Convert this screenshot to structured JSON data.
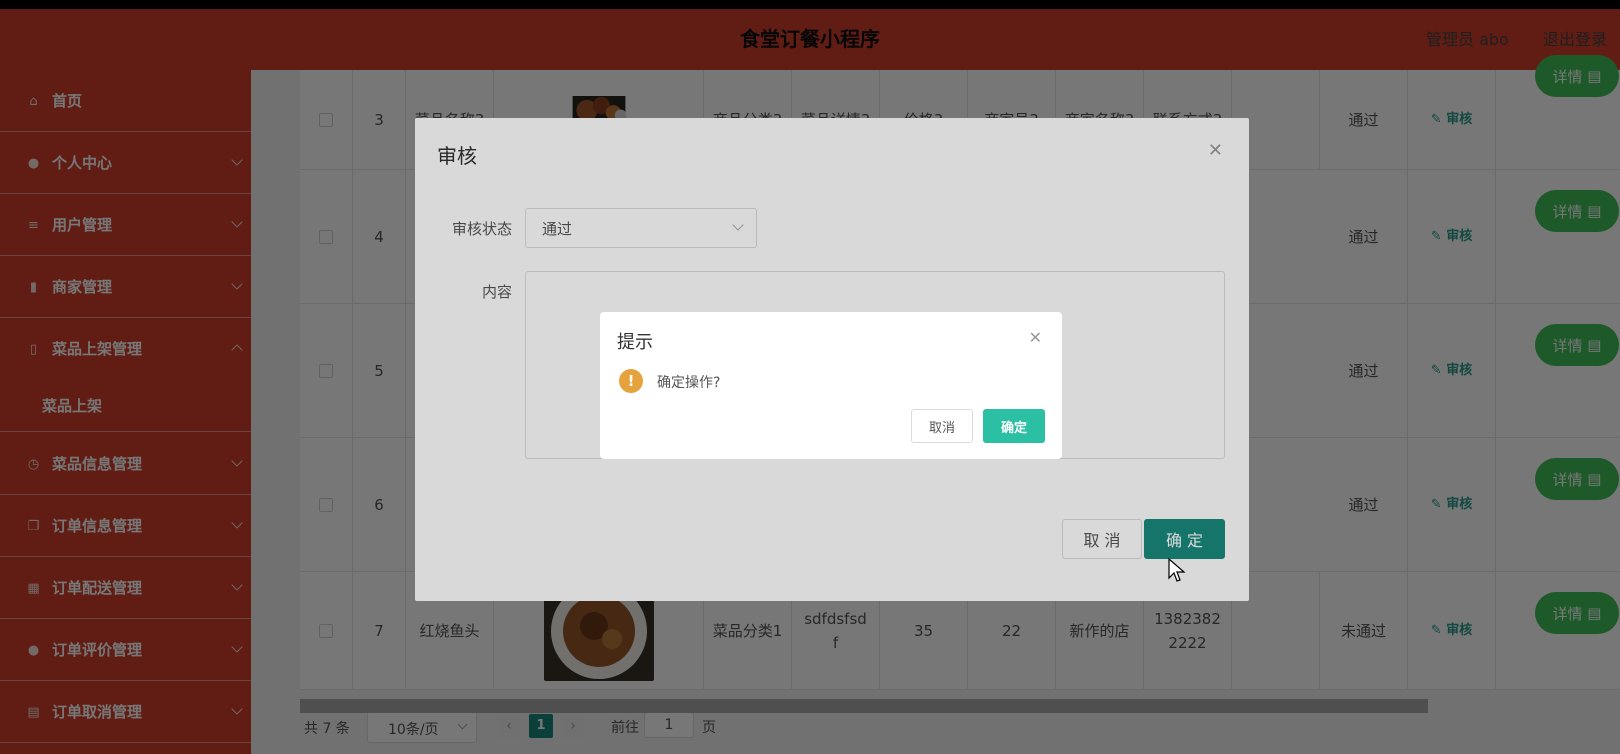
{
  "header": {
    "title": "食堂订餐小程序",
    "admin": "管理员 abo",
    "logout": "退出登录"
  },
  "sidebar": {
    "items": [
      {
        "label": "首页",
        "icon": "home-icon"
      },
      {
        "label": "个人中心",
        "icon": "user-icon"
      },
      {
        "label": "用户管理",
        "icon": "list-icon"
      },
      {
        "label": "商家管理",
        "icon": "bar-chart-icon"
      },
      {
        "label": "菜品上架管理",
        "icon": "phone-icon"
      },
      {
        "label": "菜品上架",
        "icon": ""
      },
      {
        "label": "菜品信息管理",
        "icon": "clock-icon"
      },
      {
        "label": "订单信息管理",
        "icon": "copy-icon"
      },
      {
        "label": "订单配送管理",
        "icon": "grid-icon"
      },
      {
        "label": "订单评价管理",
        "icon": "user-icon"
      },
      {
        "label": "订单取消管理",
        "icon": "doc-icon"
      }
    ]
  },
  "table": {
    "rows": [
      {
        "index": "3",
        "name": "菜品名称3",
        "category": "商品分类3",
        "detail": "菜品详情3",
        "price": "价格3",
        "merchant_no": "商家号3",
        "merchant_name": "商家名称3",
        "contact": "联系方式3",
        "status": "通过",
        "audit": "审核",
        "detail_btn": "详情"
      },
      {
        "index": "4",
        "name": "",
        "category": "",
        "detail": "",
        "price": "",
        "merchant_no": "",
        "merchant_name": "",
        "contact": "",
        "status": "通过",
        "audit": "审核",
        "detail_btn": "详情"
      },
      {
        "index": "5",
        "name": "",
        "category": "",
        "detail": "",
        "price": "",
        "merchant_no": "",
        "merchant_name": "",
        "contact": "",
        "status": "通过",
        "audit": "审核",
        "detail_btn": "详情"
      },
      {
        "index": "6",
        "name": "",
        "category": "",
        "detail": "",
        "price": "",
        "merchant_no": "",
        "merchant_name": "",
        "contact": "",
        "status": "通过",
        "audit": "审核",
        "detail_btn": "详情"
      },
      {
        "index": "7",
        "name": "红烧鱼头",
        "category": "菜品分类1",
        "detail": "sdfdsfsdf",
        "price": "35",
        "merchant_no": "22",
        "merchant_name": "新作的店",
        "contact": "13823822222",
        "status": "未通过",
        "audit": "审核",
        "detail_btn": "详情"
      }
    ]
  },
  "pager": {
    "total": "共 7 条",
    "size": "10条/页",
    "current": "1",
    "goto": "前往",
    "goto_value": "1",
    "page_word": "页"
  },
  "audit_dialog": {
    "title": "审核",
    "status_label": "审核状态",
    "status_value": "通过",
    "content_label": "内容",
    "cancel": "取 消",
    "confirm": "确 定"
  },
  "confirm_box": {
    "title": "提示",
    "message": "确定操作?",
    "cancel": "取消",
    "confirm": "确定"
  },
  "colors": {
    "header": "#d0412d",
    "sidebar": "#d0412d",
    "primary": "#1a8a7e",
    "success": "#40bf5a",
    "warning": "#e6a23c"
  }
}
